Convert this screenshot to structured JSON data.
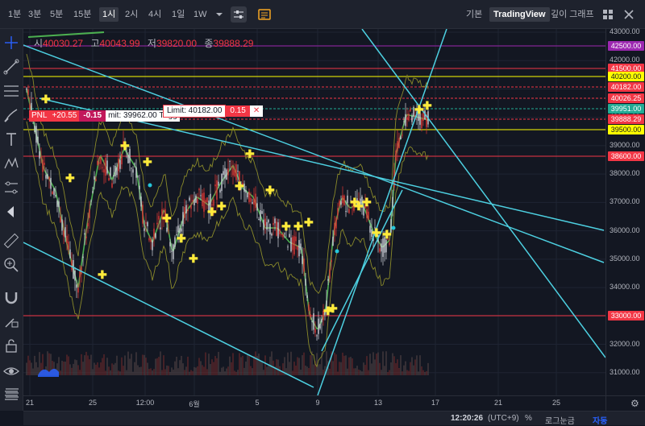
{
  "toolbar": {
    "timeframes": [
      "1분",
      "3분",
      "5분",
      "15분",
      "1시",
      "2시",
      "4시",
      "1일",
      "1W"
    ],
    "active_timeframe": "1시",
    "chart_type_icon": "dropdown-arrow",
    "indicators_icon": "sliders",
    "settings_icon": "orange-box",
    "right_tabs": [
      "기본",
      "TradingView",
      "깊이 그래프"
    ],
    "active_tab": "TradingView",
    "window_icons": [
      "grid-icon",
      "close-icon"
    ]
  },
  "ohlc": {
    "open_label": "시",
    "open": "40030.27",
    "high_label": "고",
    "high": "40043.99",
    "low_label": "저",
    "low": "39820.00",
    "close_label": "종",
    "close": "39888.29"
  },
  "orders": {
    "pnl_label": "PNL",
    "pnl_value": "+20.55",
    "pnl_qty": "-0.15",
    "pnl_detail": "mit: 39962.00 Trigg",
    "limit_label": "Limit: 40182.00",
    "limit_qty": "0.15"
  },
  "price_axis": {
    "ticks": [
      "43000.00",
      "42000.00",
      "41000.00",
      "40000.00",
      "39000.00",
      "38000.00",
      "37000.00",
      "36000.00",
      "35000.00",
      "34000.00",
      "33000.00",
      "32000.00",
      "31000.00"
    ],
    "labels": [
      {
        "text": "42500.00",
        "bg": "#9c27b0",
        "fg": "#ffffff"
      },
      {
        "text": "41500.00",
        "bg": "#f23645",
        "fg": "#ffffff"
      },
      {
        "text": "40200.00",
        "bg": "#ffff00",
        "fg": "#131722"
      },
      {
        "text": "40182.00",
        "bg": "#f23645",
        "fg": "#ffffff"
      },
      {
        "text": "40026.25",
        "bg": "#f23645",
        "fg": "#ffffff"
      },
      {
        "text": "39951.00",
        "bg": "#22ab94",
        "fg": "#ffffff"
      },
      {
        "text": "39888.29",
        "bg": "#f23645",
        "fg": "#ffffff"
      },
      {
        "text": "39500.00",
        "bg": "#ffff00",
        "fg": "#131722"
      },
      {
        "text": "38600.00",
        "bg": "#f23645",
        "fg": "#ffffff"
      },
      {
        "text": "33000.00",
        "bg": "#f23645",
        "fg": "#ffffff"
      }
    ]
  },
  "time_axis": {
    "ticks": [
      "21",
      "25",
      "12:00",
      "6월",
      "5",
      "9",
      "13",
      "17",
      "21",
      "25"
    ]
  },
  "status": {
    "time": "12:20:26",
    "timezone": "(UTC+9)",
    "percent": "%",
    "log": "로그눈금",
    "auto": "자동"
  },
  "left_tools": [
    "crosshair-icon",
    "trendline-icon",
    "fib-icon",
    "brush-icon",
    "text-icon",
    "pattern-icon",
    "measure-icon",
    "back-arrow-icon",
    "ruler-icon",
    "zoom-icon",
    "magnet-icon",
    "lock-draw-icon",
    "lock-icon",
    "eye-icon",
    "trash-icon"
  ]
}
